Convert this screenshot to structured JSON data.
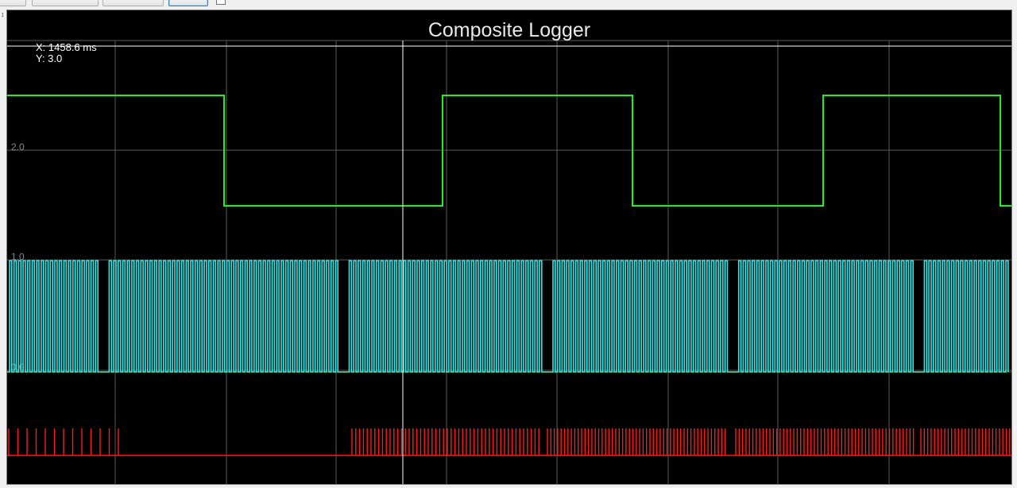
{
  "chart_data": {
    "type": "line",
    "title": "Composite Logger",
    "cursor": {
      "x_label": "X: 1458.6 ms",
      "y_label": "Y: 3.0"
    },
    "y_tick_labels": [
      "2.0",
      "1.0",
      "0.0"
    ],
    "colors": {
      "background": "#000000",
      "grid": "#5a5a5a",
      "text": "#ffffff",
      "cursor": "#ffffff",
      "cam_trace": "#22ee22",
      "crank_trace": "#22eeee",
      "trigger_trace": "#ff1a1a"
    },
    "series": [
      {
        "name": "",
        "color": "#22ee22",
        "transitions_px": [
          0,
          273,
          548,
          787,
          1027,
          1250
        ],
        "start_high": true
      },
      {
        "name": "",
        "color": "#22eeee",
        "gaps": [
          114,
          418,
          673,
          906,
          1141
        ],
        "pulse_period": 5.7
      },
      {
        "name": "",
        "color": "#ff1a1a",
        "segments": [
          [
            0,
            145,
            11.5
          ],
          [
            432,
            672,
            4.8
          ],
          [
            678,
            905,
            4.3
          ],
          [
            915,
            1143,
            4.3
          ],
          [
            1148,
            1262,
            4.3
          ]
        ]
      }
    ]
  }
}
